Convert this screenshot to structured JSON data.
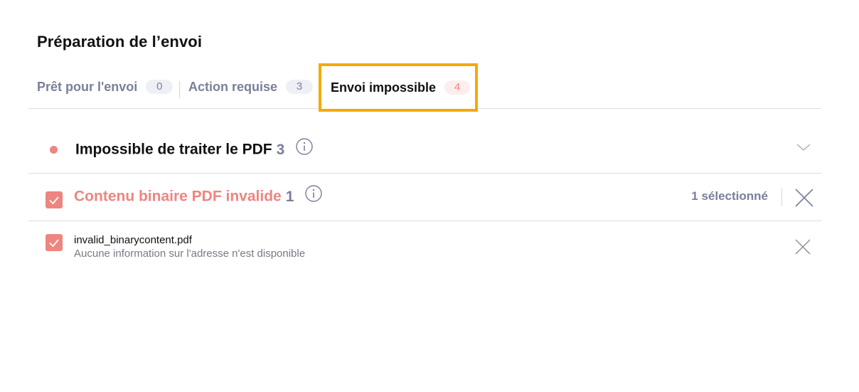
{
  "page": {
    "title": "Préparation de l’envoi"
  },
  "tabs": [
    {
      "label": "Prêt pour l'envoi",
      "count": "0"
    },
    {
      "label": "Action requise",
      "count": "3"
    },
    {
      "label": "Envoi impossible",
      "count": "4"
    }
  ],
  "group": {
    "title": "Impossible de traiter le PDF",
    "count": "3"
  },
  "subgroup": {
    "title": "Contenu binaire PDF invalide",
    "count": "1",
    "selected_label": "1 sélectionné"
  },
  "file": {
    "name": "invalid_binarycontent.pdf",
    "description": "Aucune information sur l'adresse n'est disponible"
  },
  "colors": {
    "accent_error": "#ee8580",
    "highlight": "#f4a900",
    "muted": "#7a7f99"
  },
  "icons": {
    "info": "info-icon",
    "chevron": "chevron-down-icon",
    "close": "close-icon",
    "check": "check-icon"
  }
}
